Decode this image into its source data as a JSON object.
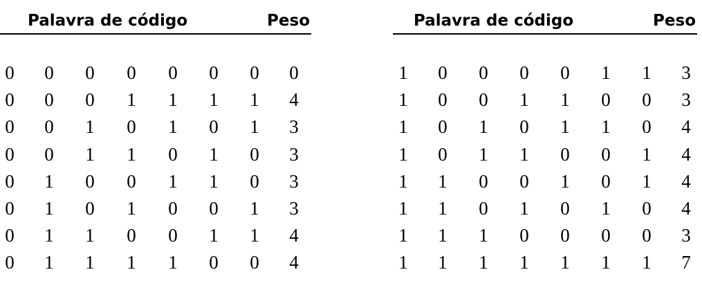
{
  "tables": [
    {
      "header": {
        "codeword": "Palavra de código",
        "weight": "Peso"
      },
      "rows": [
        {
          "bits": [
            "0",
            "0",
            "0",
            "0",
            "0",
            "0",
            "0"
          ],
          "weight": "0"
        },
        {
          "bits": [
            "0",
            "0",
            "0",
            "1",
            "1",
            "1",
            "1"
          ],
          "weight": "4"
        },
        {
          "bits": [
            "0",
            "0",
            "1",
            "0",
            "1",
            "0",
            "1"
          ],
          "weight": "3"
        },
        {
          "bits": [
            "0",
            "0",
            "1",
            "1",
            "0",
            "1",
            "0"
          ],
          "weight": "3"
        },
        {
          "bits": [
            "0",
            "1",
            "0",
            "0",
            "1",
            "1",
            "0"
          ],
          "weight": "3"
        },
        {
          "bits": [
            "0",
            "1",
            "0",
            "1",
            "0",
            "0",
            "1"
          ],
          "weight": "3"
        },
        {
          "bits": [
            "0",
            "1",
            "1",
            "0",
            "0",
            "1",
            "1"
          ],
          "weight": "4"
        },
        {
          "bits": [
            "0",
            "1",
            "1",
            "1",
            "1",
            "0",
            "0"
          ],
          "weight": "4"
        }
      ]
    },
    {
      "header": {
        "codeword": "Palavra de código",
        "weight": "Peso"
      },
      "rows": [
        {
          "bits": [
            "1",
            "0",
            "0",
            "0",
            "0",
            "1",
            "1"
          ],
          "weight": "3"
        },
        {
          "bits": [
            "1",
            "0",
            "0",
            "1",
            "1",
            "0",
            "0"
          ],
          "weight": "3"
        },
        {
          "bits": [
            "1",
            "0",
            "1",
            "0",
            "1",
            "1",
            "0"
          ],
          "weight": "4"
        },
        {
          "bits": [
            "1",
            "0",
            "1",
            "1",
            "0",
            "0",
            "1"
          ],
          "weight": "4"
        },
        {
          "bits": [
            "1",
            "1",
            "0",
            "0",
            "1",
            "0",
            "1"
          ],
          "weight": "4"
        },
        {
          "bits": [
            "1",
            "1",
            "0",
            "1",
            "0",
            "1",
            "0"
          ],
          "weight": "4"
        },
        {
          "bits": [
            "1",
            "1",
            "1",
            "0",
            "0",
            "0",
            "0"
          ],
          "weight": "3"
        },
        {
          "bits": [
            "1",
            "1",
            "1",
            "1",
            "1",
            "1",
            "1"
          ],
          "weight": "7"
        }
      ]
    }
  ]
}
